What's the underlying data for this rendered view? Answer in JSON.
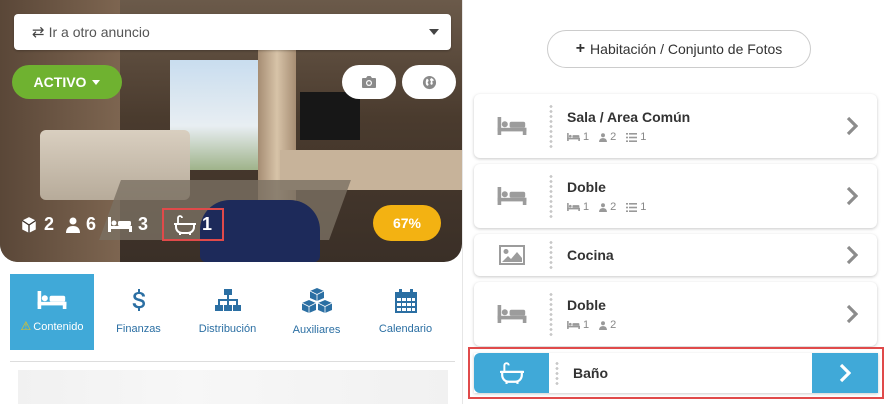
{
  "listing": {
    "select_label": "Ir a otro anuncio",
    "status_label": "ACTIVO",
    "stats": {
      "rooms": "2",
      "guests": "6",
      "beds": "3",
      "baths": "1"
    },
    "completion": "67%"
  },
  "tabs": [
    {
      "label": "Contenido",
      "icon": "bed-icon",
      "active": true,
      "warning": true
    },
    {
      "label": "Finanzas",
      "icon": "dollar-icon"
    },
    {
      "label": "Distribución",
      "icon": "sitemap-icon"
    },
    {
      "label": "Auxiliares",
      "icon": "cubes-icon"
    },
    {
      "label": "Calendario",
      "icon": "calendar-icon"
    }
  ],
  "right": {
    "add_button_label": "Habitación / Conjunto de Fotos",
    "rooms": [
      {
        "name": "Sala / Area Común",
        "icon": "bed-icon",
        "beds": "1",
        "guests": "2",
        "items": "1"
      },
      {
        "name": "Doble",
        "icon": "bed-icon",
        "beds": "1",
        "guests": "2",
        "items": "1"
      },
      {
        "name": "Cocina",
        "icon": "image-icon"
      },
      {
        "name": "Doble",
        "icon": "bed-icon",
        "beds": "1",
        "guests": "2"
      },
      {
        "name": "Baño",
        "icon": "bath-icon",
        "selected": true
      }
    ]
  },
  "colors": {
    "accent_blue": "#40a9d8",
    "status_green": "#6fb230",
    "badge_yellow": "#f3b212",
    "highlight_red": "#e04a4a"
  }
}
